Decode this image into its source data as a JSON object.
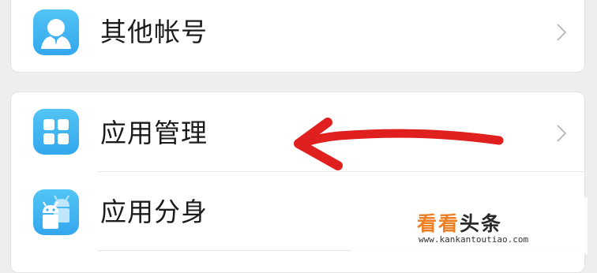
{
  "settings": {
    "items": [
      {
        "label": "其他帐号",
        "icon": "account-icon"
      },
      {
        "label": "应用管理",
        "icon": "app-grid-icon"
      },
      {
        "label": "应用分身",
        "icon": "android-clone-icon"
      }
    ]
  },
  "watermark": {
    "logo_accent": "看看",
    "logo_rest": "头条",
    "url": "www.kankantoutiao.com"
  },
  "colors": {
    "icon_blue": "#3aaef0",
    "annotation_red": "#e01f1f",
    "watermark_orange": "#ee7f22"
  }
}
